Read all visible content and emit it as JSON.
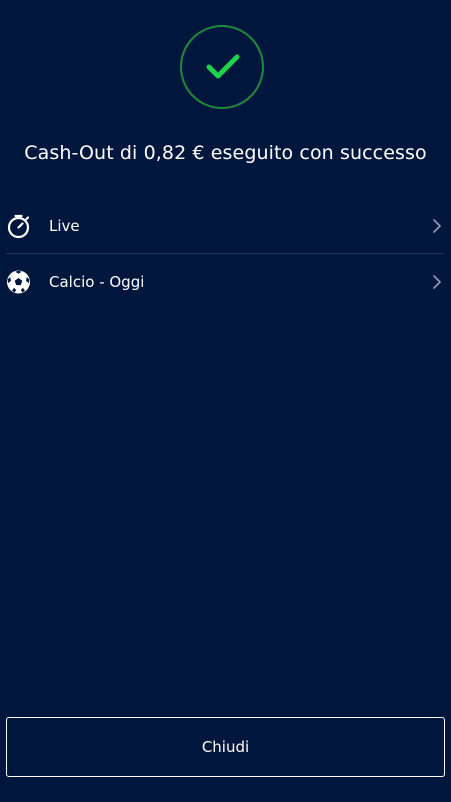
{
  "dialog": {
    "status_icon": "check-icon",
    "title": "Cash-Out di 0,82 € eseguito con successo",
    "accent_color": "#1fd04a",
    "ring_color": "#1e8a3e",
    "background_color": "#01163d"
  },
  "menu": {
    "items": [
      {
        "label": "Live",
        "icon": "stopwatch-icon"
      },
      {
        "label": "Calcio - Oggi",
        "icon": "soccer-ball-icon"
      }
    ],
    "chevron_icon": "chevron-right-icon"
  },
  "footer": {
    "close_label": "Chiudi"
  }
}
